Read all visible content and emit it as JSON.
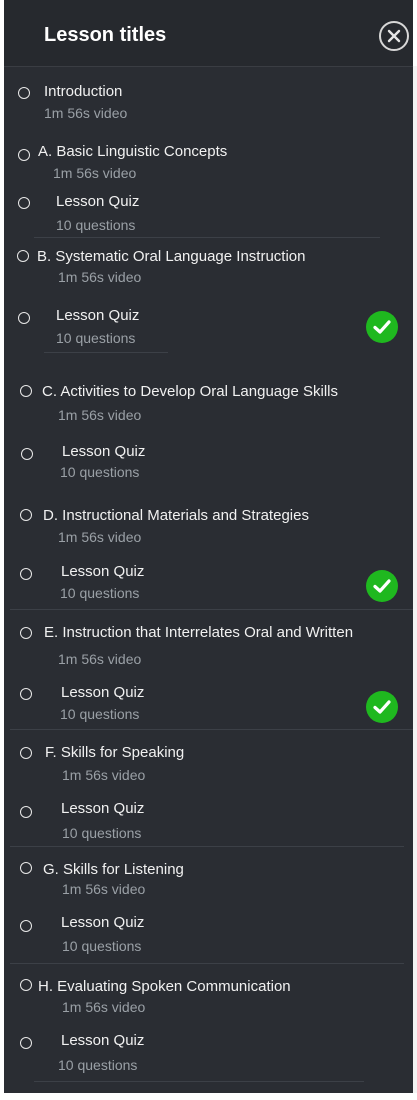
{
  "header": {
    "title": "Lesson titles"
  },
  "items": [
    {
      "title": "Introduction",
      "sub": "1m 56s video",
      "done": false
    },
    {
      "title": "A. Basic Linguistic Concepts",
      "sub": "1m 56s video",
      "done": false
    },
    {
      "title": "Lesson Quiz",
      "sub": "10 questions",
      "done": false
    },
    {
      "title": "B. Systematic Oral Language Instruction",
      "sub": "1m 56s video",
      "done": false
    },
    {
      "title": "Lesson Quiz",
      "sub": "10 questions",
      "done": true
    },
    {
      "title": "C. Activities to Develop Oral Language Skills",
      "sub": "1m 56s video",
      "done": false
    },
    {
      "title": "Lesson Quiz",
      "sub": "10 questions",
      "done": false
    },
    {
      "title": "D. Instructional Materials and Strategies",
      "sub": "1m 56s video",
      "done": false
    },
    {
      "title": "Lesson Quiz",
      "sub": "10 questions",
      "done": true
    },
    {
      "title": "E. Instruction that Interrelates Oral and Written",
      "sub": "1m 56s video",
      "done": false
    },
    {
      "title": "Lesson Quiz",
      "sub": "10 questions",
      "done": true
    },
    {
      "title": "F. Skills for Speaking",
      "sub": "1m 56s video",
      "done": false
    },
    {
      "title": "Lesson Quiz",
      "sub": "10 questions",
      "done": false
    },
    {
      "title": "G. Skills for Listening",
      "sub": "1m 56s video",
      "done": false
    },
    {
      "title": "Lesson Quiz",
      "sub": "10 questions",
      "done": false
    },
    {
      "title": "H. Evaluating Spoken Communication",
      "sub": "1m 56s video",
      "done": false
    },
    {
      "title": "Lesson Quiz",
      "sub": "10 questions",
      "done": false
    }
  ],
  "colors": {
    "panel": "#2a2d33",
    "complete": "#1fb81f",
    "subtext": "#9aa0a6"
  }
}
